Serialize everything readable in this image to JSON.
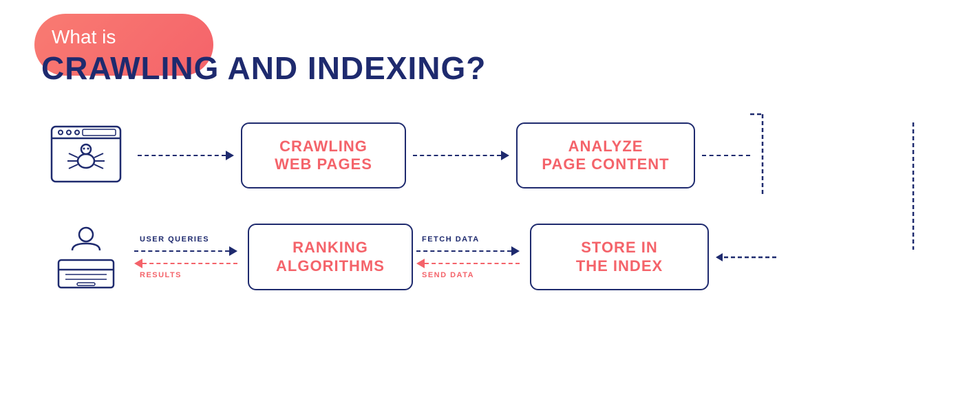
{
  "header": {
    "subtitle": "What is",
    "title": "CRAWLING AND INDEXING?"
  },
  "diagram": {
    "row1": {
      "arrow1_label": "",
      "box1_label": "CRAWLING\nWEB PAGES",
      "arrow2_label": "",
      "box2_label": "ANALYZE\nPAGE CONTENT"
    },
    "row2": {
      "arrow_top_label": "USER QUERIES",
      "arrow_bottom_label": "RESULTS",
      "box1_label": "RANKING\nALGORITHMS",
      "arrow2_top_label": "FETCH DATA",
      "arrow2_bottom_label": "SEND DATA",
      "box2_label": "STORE IN\nTHE INDEX"
    }
  },
  "colors": {
    "dark_blue": "#1e2a6e",
    "red": "#f4636a",
    "white": "#ffffff"
  }
}
